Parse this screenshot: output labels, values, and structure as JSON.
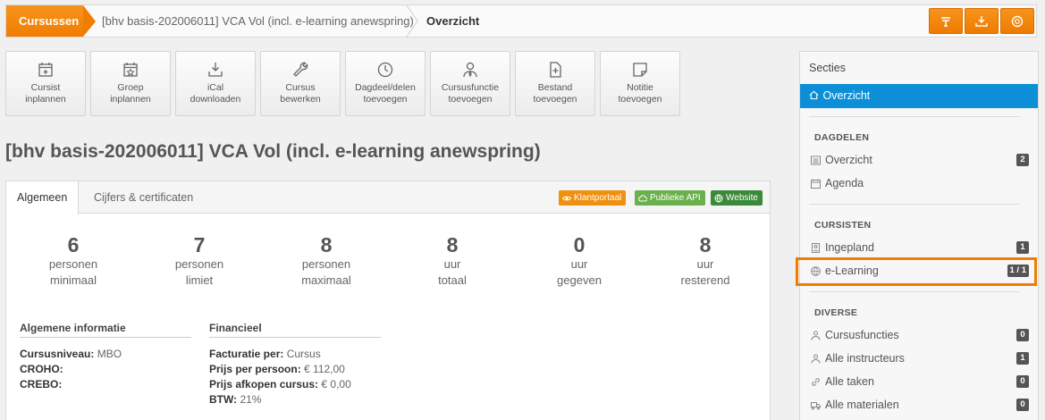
{
  "breadcrumb": {
    "home": "Cursussen",
    "course": "[bhv basis-202006011] VCA Vol (incl. e-learning anewspring)",
    "current": "Overzicht"
  },
  "toolbar_icons": [
    "filter-icon",
    "download-icon",
    "help-icon"
  ],
  "actions": [
    {
      "label": "Cursist\ninplannen",
      "icon": "calendar-plus-icon"
    },
    {
      "label": "Groep\ninplannen",
      "icon": "calendar-star-icon"
    },
    {
      "label": "iCal\ndownloaden",
      "icon": "download-tray-icon"
    },
    {
      "label": "Cursus\nbewerken",
      "icon": "wrench-icon"
    },
    {
      "label": "Dagdeel/delen\ntoevoegen",
      "icon": "clock-icon"
    },
    {
      "label": "Cursusfunctie\ntoevoegen",
      "icon": "user-tie-icon"
    },
    {
      "label": "Bestand\ntoevoegen",
      "icon": "file-plus-icon"
    },
    {
      "label": "Notitie\ntoevoegen",
      "icon": "note-icon"
    }
  ],
  "page_title": "[bhv basis-202006011] VCA Vol (incl. e-learning anewspring)",
  "tabs": [
    {
      "label": "Algemeen",
      "active": true
    },
    {
      "label": "Cijfers & certificaten",
      "active": false
    }
  ],
  "links": [
    {
      "label": "Klantportaal",
      "color": "#f0900f",
      "icon": "eye-icon"
    },
    {
      "label": "Publieke API",
      "color": "#6ab04c",
      "icon": "cloud-icon"
    },
    {
      "label": "Website",
      "color": "#3a8a3a",
      "icon": "globe-icon"
    }
  ],
  "stats": [
    {
      "num": "6",
      "l1": "personen",
      "l2": "minimaal"
    },
    {
      "num": "7",
      "l1": "personen",
      "l2": "limiet"
    },
    {
      "num": "8",
      "l1": "personen",
      "l2": "maximaal"
    },
    {
      "num": "8",
      "l1": "uur",
      "l2": "totaal"
    },
    {
      "num": "0",
      "l1": "uur",
      "l2": "gegeven"
    },
    {
      "num": "8",
      "l1": "uur",
      "l2": "resterend"
    }
  ],
  "general": {
    "title": "Algemene informatie",
    "rows": [
      {
        "key": "Cursusniveau:",
        "val": " MBO"
      },
      {
        "key": "CROHO:",
        "val": ""
      },
      {
        "key": "CREBO:",
        "val": ""
      }
    ]
  },
  "finance": {
    "title": "Financieel",
    "rows": [
      {
        "key": "Facturatie per:",
        "val": " Cursus"
      },
      {
        "key": "Prijs per persoon:",
        "val": " € 112,00"
      },
      {
        "key": "Prijs afkopen cursus:",
        "val": " € 0,00"
      },
      {
        "key": "BTW:",
        "val": " 21%"
      }
    ]
  },
  "sidebar": {
    "title": "Secties",
    "active": "Overzicht",
    "groups": [
      {
        "label": "DAGDELEN",
        "items": [
          {
            "label": "Overzicht",
            "count": "2",
            "icon": "list-icon"
          },
          {
            "label": "Agenda",
            "count": "",
            "icon": "calendar-icon"
          }
        ]
      },
      {
        "label": "CURSISTEN",
        "items": [
          {
            "label": "Ingepland",
            "count": "1",
            "icon": "id-card-icon"
          },
          {
            "label": "e-Learning",
            "count": "1 / 1",
            "icon": "globe-icon"
          }
        ]
      },
      {
        "label": "DIVERSE",
        "items": [
          {
            "label": "Cursusfuncties",
            "count": "0",
            "icon": "user-tie-icon"
          },
          {
            "label": "Alle instructeurs",
            "count": "1",
            "icon": "user-icon"
          },
          {
            "label": "Alle taken",
            "count": "0",
            "icon": "link-icon"
          },
          {
            "label": "Alle materialen",
            "count": "0",
            "icon": "truck-icon"
          }
        ]
      }
    ]
  }
}
